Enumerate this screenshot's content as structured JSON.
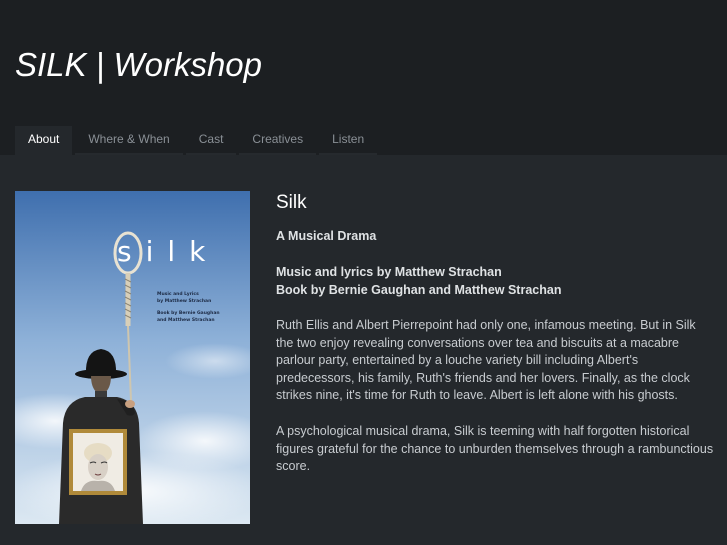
{
  "site": {
    "title": "SILK | Workshop"
  },
  "nav": {
    "items": [
      {
        "label": "About",
        "active": true
      },
      {
        "label": "Where & When",
        "active": false
      },
      {
        "label": "Cast",
        "active": false
      },
      {
        "label": "Creatives",
        "active": false
      },
      {
        "label": "Listen",
        "active": false
      }
    ]
  },
  "poster": {
    "word": "silk",
    "credit_music": "Music and Lyrics",
    "credit_music_by": "by Matthew Strachan",
    "credit_book": "Book by Bernie Gaughan",
    "credit_book_by": "and Matthew Strachan"
  },
  "article": {
    "heading": "Silk",
    "subtitle": "A Musical Drama",
    "credit_line1": "Music and lyrics by Matthew Strachan",
    "credit_line2": "Book by Bernie Gaughan and Matthew Strachan",
    "paragraph1": "Ruth Ellis and Albert Pierrepoint had only one, infamous meeting. But in Silk the two enjoy revealing conversations over tea and biscuits at a macabre parlour party, entertained by a louche variety bill including Albert's predecessors, his family, Ruth's friends and her lovers. Finally, as the clock strikes nine, it's time for Ruth to leave. Albert is left alone with his ghosts.",
    "paragraph2": "A psychological musical drama, Silk is teeming with half forgotten historical figures grateful for the chance to unburden themselves through a rambunctious score."
  },
  "colors": {
    "header_bg": "#1c1f22",
    "page_bg": "#24282c",
    "accent": "#ffffff"
  }
}
